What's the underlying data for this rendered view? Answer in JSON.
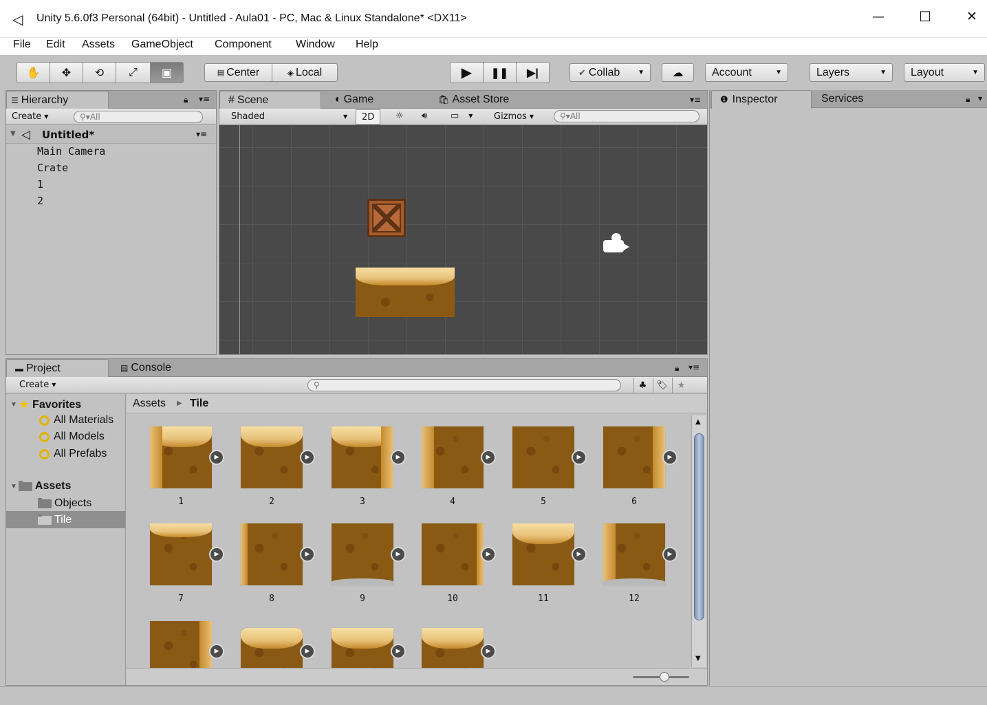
{
  "window": {
    "title": "Unity 5.6.0f3 Personal (64bit) - Untitled - Aula01 - PC, Mac & Linux Standalone* <DX11>",
    "controls": {
      "minimize": "—",
      "maximize": "☐",
      "close": "✕"
    }
  },
  "menu": [
    "File",
    "Edit",
    "Assets",
    "GameObject",
    "Component",
    "Window",
    "Help"
  ],
  "toolbar": {
    "tools": [
      "✋",
      "✥",
      "⟲",
      "⤢",
      "▣"
    ],
    "pivot": "Center",
    "space": "Local",
    "play": "▶",
    "pause": "❚❚",
    "step": "▶|",
    "collab": "Collab",
    "cloud": "☁",
    "account": "Account",
    "layers": "Layers",
    "layout": "Layout"
  },
  "hierarchy": {
    "tab": "Hierarchy",
    "create": "Create",
    "search_placeholder": "All",
    "scene": "Untitled*",
    "items": [
      "Main Camera",
      "Crate",
      "1",
      "2"
    ]
  },
  "scene_view": {
    "tabs": [
      "Scene",
      "Game",
      "Asset Store"
    ],
    "shading": "Shaded",
    "mode2d": "2D",
    "gizmos": "Gizmos",
    "search_placeholder": "All"
  },
  "inspector": {
    "tabs": [
      "Inspector",
      "Services"
    ]
  },
  "project": {
    "tabs": [
      "Project",
      "Console"
    ],
    "create": "Create",
    "favorites": {
      "label": "Favorites",
      "items": [
        "All Materials",
        "All Models",
        "All Prefabs"
      ]
    },
    "assets": {
      "label": "Assets",
      "items": [
        "Objects",
        "Tile"
      ]
    },
    "breadcrumb": [
      "Assets",
      "Tile"
    ],
    "tiles": [
      "1",
      "2",
      "3",
      "4",
      "5",
      "6",
      "7",
      "8",
      "9",
      "10",
      "11",
      "12",
      "",
      "",
      "",
      ""
    ]
  },
  "colors": {
    "scene_bg": "#494949",
    "panel_bg": "#c2c2c2",
    "selection": "#8f8f8f",
    "dirt": "#8a5a14",
    "sand": "#f1d49a"
  }
}
